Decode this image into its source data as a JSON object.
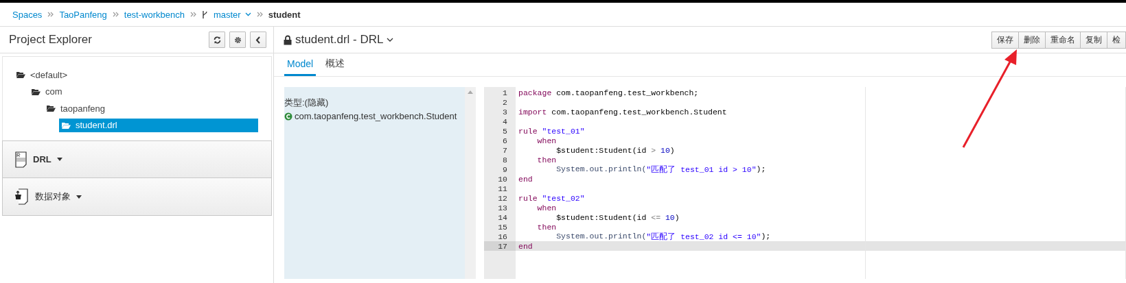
{
  "breadcrumbs": [
    {
      "label": "Spaces",
      "kind": "link"
    },
    {
      "label": "TaoPanfeng",
      "kind": "link"
    },
    {
      "label": "test-workbench",
      "kind": "link"
    },
    {
      "label": "master",
      "kind": "branch"
    },
    {
      "label": "student",
      "kind": "current"
    }
  ],
  "explorer": {
    "title": "Project Explorer",
    "tree": [
      {
        "label": "<default>",
        "selected": false,
        "children": [
          {
            "label": "com",
            "selected": false,
            "children": [
              {
                "label": "taopanfeng",
                "selected": false,
                "children": [
                  {
                    "label": "student.drl",
                    "selected": true
                  }
                ]
              }
            ]
          }
        ]
      }
    ],
    "sections": [
      {
        "label": "DRL",
        "kind": "drl"
      },
      {
        "label": "数据对象",
        "kind": "data-object"
      }
    ]
  },
  "editor": {
    "title": "student.drl - DRL",
    "locked": true,
    "tabs": [
      {
        "label": "Model",
        "selected": true
      },
      {
        "label": "概述",
        "selected": false
      }
    ],
    "actions": [
      "保存",
      "删除",
      "重命名",
      "复制",
      "检"
    ],
    "model": {
      "caption": "类型:(隐藏)",
      "items": [
        "com.taopanfeng.test_workbench.Student"
      ]
    },
    "lines": [
      {
        "number": "1",
        "active": false,
        "tokens": [
          {
            "kind": "keyword",
            "text": "package"
          },
          {
            "kind": "plain",
            "text": " com.taopanfeng.test_workbench;"
          }
        ]
      },
      {
        "number": "2",
        "active": false
      },
      {
        "number": "3",
        "active": false,
        "tokens": [
          {
            "kind": "keyword",
            "text": "import"
          },
          {
            "kind": "plain",
            "text": " com.taopanfeng.test_workbench.Student"
          }
        ]
      },
      {
        "number": "4",
        "active": false
      },
      {
        "number": "5",
        "active": false,
        "tokens": [
          {
            "kind": "keyword",
            "text": "rule"
          },
          {
            "kind": "string",
            "text": " \"test_01\""
          }
        ]
      },
      {
        "number": "6",
        "active": false,
        "tokens": [
          {
            "kind": "keyword",
            "text": "    when"
          }
        ]
      },
      {
        "number": "7",
        "active": false,
        "tokens": [
          {
            "kind": "plain",
            "text": "        $student:Student(id "
          },
          {
            "kind": "operator",
            "text": ">"
          },
          {
            "kind": "number",
            "text": " 10"
          },
          {
            "kind": "plain",
            "text": ")"
          }
        ]
      },
      {
        "number": "8",
        "active": false,
        "tokens": [
          {
            "kind": "keyword",
            "text": "    then"
          }
        ]
      },
      {
        "number": "9",
        "active": false,
        "tokens": [
          {
            "kind": "call",
            "text": "        System.out.println("
          },
          {
            "kind": "string",
            "text": "\"匹配了 test_01 id > 10\""
          },
          {
            "kind": "plain",
            "text": ");"
          }
        ]
      },
      {
        "number": "10",
        "active": false,
        "tokens": [
          {
            "kind": "keyword",
            "text": "end"
          }
        ]
      },
      {
        "number": "11",
        "active": false
      },
      {
        "number": "12",
        "active": false,
        "tokens": [
          {
            "kind": "keyword",
            "text": "rule"
          },
          {
            "kind": "string",
            "text": " \"test_02\""
          }
        ]
      },
      {
        "number": "13",
        "active": false,
        "tokens": [
          {
            "kind": "keyword",
            "text": "    when"
          }
        ]
      },
      {
        "number": "14",
        "active": false,
        "tokens": [
          {
            "kind": "plain",
            "text": "        $student:Student(id "
          },
          {
            "kind": "operator",
            "text": "<="
          },
          {
            "kind": "number",
            "text": " 10"
          },
          {
            "kind": "plain",
            "text": ")"
          }
        ]
      },
      {
        "number": "15",
        "active": false,
        "tokens": [
          {
            "kind": "keyword",
            "text": "    then"
          }
        ]
      },
      {
        "number": "16",
        "active": false,
        "tokens": [
          {
            "kind": "call",
            "text": "        System.out.println("
          },
          {
            "kind": "string",
            "text": "\"匹配了 test_02 id <= 10\""
          },
          {
            "kind": "plain",
            "text": ");"
          }
        ]
      },
      {
        "number": "17",
        "active": true,
        "tokens": [
          {
            "kind": "keyword",
            "text": "end"
          }
        ]
      }
    ]
  }
}
